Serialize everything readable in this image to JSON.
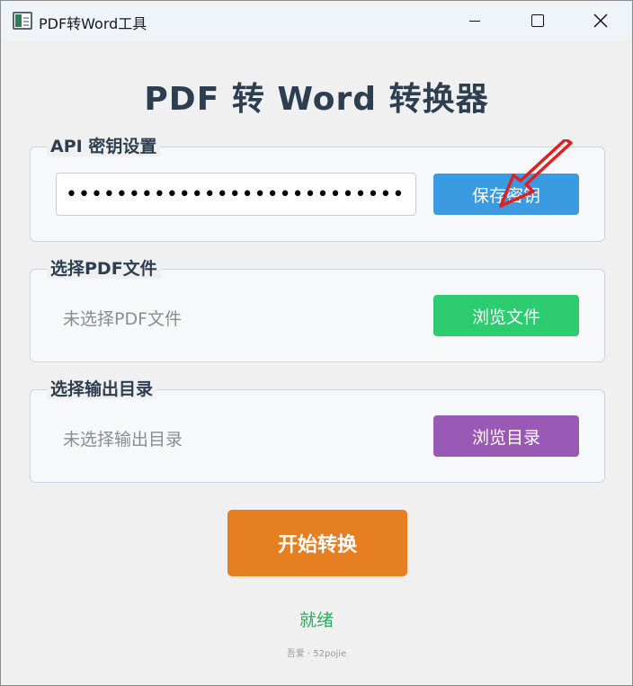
{
  "window": {
    "title": "PDF转Word工具",
    "min_icon": "minimize-icon",
    "max_icon": "maximize-icon",
    "close_icon": "close-icon"
  },
  "main_title": "PDF 转 Word 转换器",
  "api_section": {
    "label": "API 密钥设置",
    "key_value": "••••••••••••••••••••••••••••••••",
    "save_button": "保存密钥"
  },
  "pdf_section": {
    "label": "选择PDF文件",
    "status": "未选择PDF文件",
    "browse_button": "浏览文件"
  },
  "output_section": {
    "label": "选择输出目录",
    "status": "未选择输出目录",
    "browse_button": "浏览目录"
  },
  "start_button": "开始转换",
  "status_text": "就绪",
  "credit": "吾爱 · 52pojie",
  "colors": {
    "save": "#3a9be0",
    "browse_file": "#2ecc71",
    "browse_dir": "#9b59b6",
    "start": "#e67e22",
    "status": "#27ae60",
    "annotation_arrow": "#e02020"
  }
}
